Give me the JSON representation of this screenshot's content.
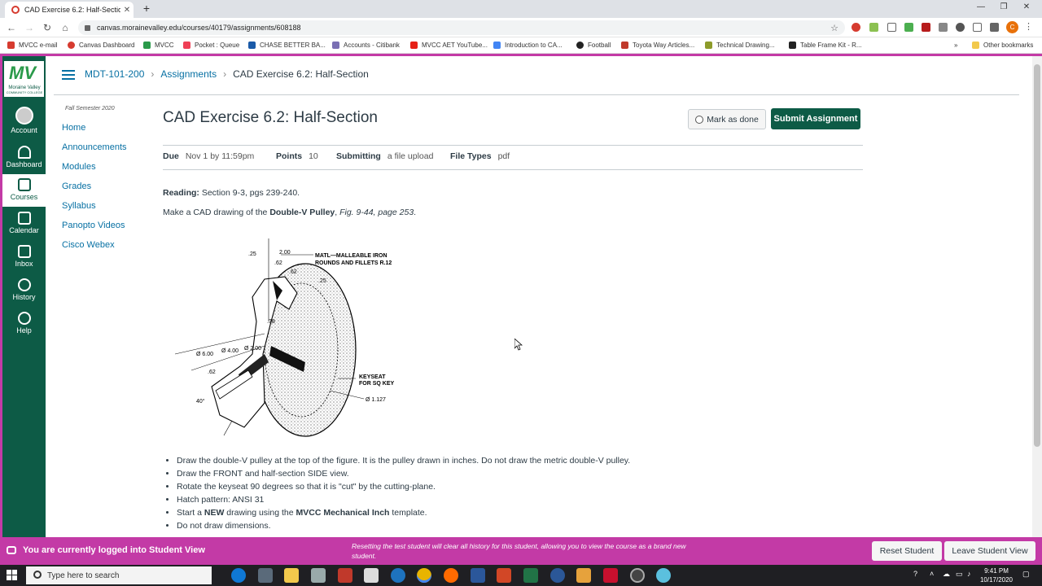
{
  "browser": {
    "tab_title": "CAD Exercise 6.2: Half-Section",
    "url": "canvas.morainevalley.edu/courses/40179/assignments/608188",
    "profile_initial": "C",
    "bookmarks": [
      "MVCC e-mail",
      "Canvas Dashboard",
      "MVCC",
      "Pocket : Queue",
      "CHASE BETTER BA...",
      "Accounts - Citibank",
      "MVCC AET YouTube...",
      "Introduction to CA...",
      "Football",
      "Toyota Way Articles...",
      "Technical Drawing...",
      "Table Frame Kit - R...",
      "Other bookmarks"
    ]
  },
  "global_nav": {
    "logo_text": "Moraine Valley",
    "logo_sub": "COMMUNITY COLLEGE",
    "items": [
      "Account",
      "Dashboard",
      "Courses",
      "Calendar",
      "Inbox",
      "History",
      "Help"
    ]
  },
  "breadcrumb": {
    "course": "MDT-101-200",
    "section": "Assignments",
    "current": "CAD Exercise 6.2: Half-Section"
  },
  "course_nav": {
    "term": "Fall Semester 2020",
    "links": [
      "Home",
      "Announcements",
      "Modules",
      "Grades",
      "Syllabus",
      "Panopto Videos",
      "Cisco Webex"
    ]
  },
  "assignment": {
    "title": "CAD Exercise 6.2: Half-Section",
    "mark_done": "Mark as done",
    "submit": "Submit Assignment",
    "due_label": "Due",
    "due_value": "Nov 1 by 11:59pm",
    "points_label": "Points",
    "points_value": "10",
    "submitting_label": "Submitting",
    "submitting_value": "a file upload",
    "filetypes_label": "File Types",
    "filetypes_value": "pdf",
    "reading_label": "Reading:",
    "reading_value": "Section 9-3, pgs 239-240.",
    "instr_prefix": "Make a CAD drawing of the ",
    "instr_bold": "Double-V Pulley",
    "instr_mid": ", ",
    "instr_italic": "Fig. 9-44, page 253",
    "instr_end": ".",
    "bullets": [
      {
        "parts": [
          "Draw the double-V pulley at the top of the figure.  It is the pulley drawn in inches.  Do not draw the metric double-V pulley."
        ]
      },
      {
        "parts": [
          "Draw the FRONT and half-section SIDE view."
        ]
      },
      {
        "parts": [
          "Rotate the keyseat 90 degrees so that it is \"cut\" by the cutting-plane."
        ]
      },
      {
        "parts": [
          "Hatch pattern:  ANSI 31"
        ]
      },
      {
        "a": "Start a ",
        "b": "NEW",
        "c": " drawing using the ",
        "d": "MVCC Mechanical Inch",
        "e": " template."
      },
      {
        "parts": [
          "Do not draw dimensions."
        ]
      }
    ]
  },
  "drawing_labels": {
    "matl1": "MATL—MALLEABLE IRON",
    "matl2": "ROUNDS AND FILLETS R.12",
    "d25a": ".25",
    "d200": "2.00",
    "d62a": ".62",
    "d62b": ".62",
    "d25b": ".25",
    "d38": ".38",
    "dia600": "Ø 6.00",
    "dia400": "Ø 4.00",
    "dia200": "Ø 2.00",
    "d62c": ".62",
    "keyseat1": "KEYSEAT",
    "keyseat2": "FOR SQ KEY",
    "dia1127": "Ø 1.127",
    "ang40": "40°"
  },
  "student_view": {
    "message": "You are currently logged into Student View",
    "note": "Resetting the test student will clear all history for this student, allowing you to view the course as a brand new student.",
    "reset": "Reset Student",
    "leave": "Leave Student View"
  },
  "taskbar": {
    "search_placeholder": "Type here to search",
    "time": "9:41 PM",
    "date": "10/17/2020"
  }
}
